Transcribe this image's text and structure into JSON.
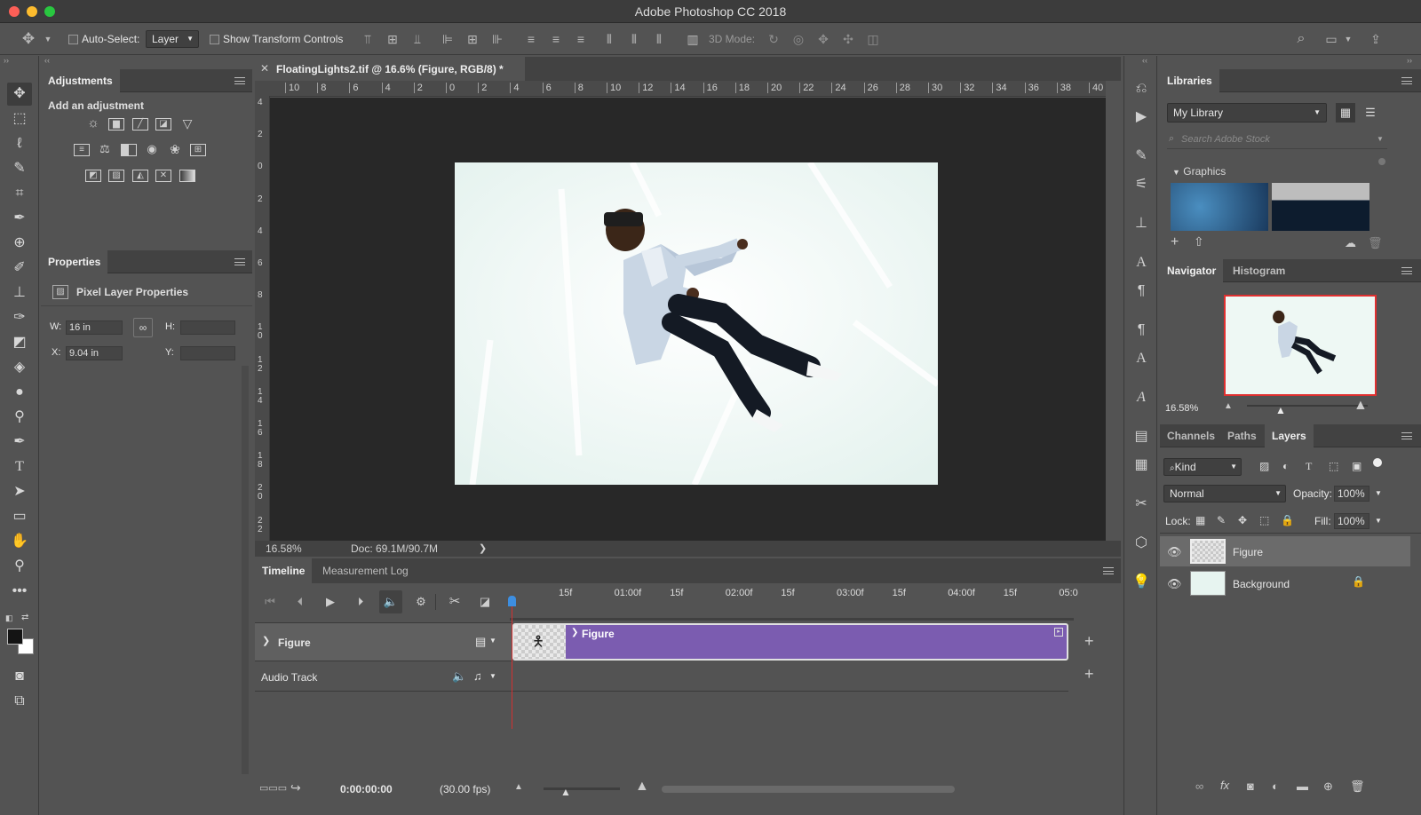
{
  "app": {
    "title": "Adobe Photoshop CC 2018"
  },
  "options_bar": {
    "auto_select_label": "Auto-Select:",
    "auto_select_target": "Layer",
    "show_transform_label": "Show Transform Controls",
    "mode_3d_label": "3D Mode:"
  },
  "adjustments": {
    "tab_label": "Adjustments",
    "subtitle": "Add an adjustment",
    "rows": [
      [
        "brightness-contrast-icon",
        "levels-icon",
        "curves-icon",
        "exposure-icon",
        "vibrance-icon"
      ],
      [
        "hue-saturation-icon",
        "color-balance-icon",
        "black-white-icon",
        "photo-filter-icon",
        "channel-mixer-icon",
        "color-lookup-icon"
      ],
      [
        "invert-icon",
        "posterize-icon",
        "threshold-icon",
        "selective-color-icon",
        "gradient-map-icon"
      ]
    ]
  },
  "properties": {
    "tab_label": "Properties",
    "section_label": "Pixel Layer Properties",
    "w_label": "W:",
    "w_value": "16 in",
    "h_label": "H:",
    "h_value": "",
    "x_label": "X:",
    "x_value": "9.04 in",
    "y_label": "Y:",
    "y_value": ""
  },
  "document": {
    "tab_title": "FloatingLights2.tif @ 16.6% (Figure, RGB/8) *",
    "ruler_h": [
      "10",
      "8",
      "6",
      "4",
      "2",
      "0",
      "2",
      "4",
      "6",
      "8",
      "10",
      "12",
      "14",
      "16",
      "18",
      "20",
      "22",
      "24",
      "26",
      "28",
      "30",
      "32",
      "34",
      "36",
      "38",
      "40"
    ],
    "ruler_v": [
      "4",
      "2",
      "0",
      "2",
      "4",
      "6",
      "8",
      "1\n0",
      "1\n2",
      "1\n4",
      "1\n6",
      "1\n8",
      "2\n0",
      "2\n2"
    ],
    "zoom": "16.58%",
    "doc_size": "Doc: 69.1M/90.7M"
  },
  "timeline": {
    "tabs": [
      "Timeline",
      "Measurement Log"
    ],
    "ticks": [
      "15f",
      "01:00f",
      "15f",
      "02:00f",
      "15f",
      "03:00f",
      "15f",
      "04:00f",
      "15f",
      "05:0"
    ],
    "tracks": [
      {
        "name": "Figure",
        "clip": "Figure"
      },
      {
        "name": "Audio Track"
      }
    ],
    "current_time": "0:00:00:00",
    "fps": "(30.00 fps)"
  },
  "libraries": {
    "tab_label": "Libraries",
    "library_name": "My Library",
    "search_placeholder": "Search Adobe Stock",
    "section_label": "Graphics"
  },
  "navigator": {
    "tabs": [
      "Navigator",
      "Histogram"
    ],
    "zoom": "16.58%"
  },
  "layers_panel": {
    "tabs": [
      "Channels",
      "Paths",
      "Layers"
    ],
    "filter_label": "Kind",
    "blend_mode": "Normal",
    "opacity_label": "Opacity:",
    "opacity_value": "100%",
    "lock_label": "Lock:",
    "fill_label": "Fill:",
    "fill_value": "100%",
    "layers": [
      {
        "name": "Figure",
        "selected": true
      },
      {
        "name": "Background",
        "locked": true
      }
    ]
  },
  "colors": {
    "accent_clip": "#7b5cb0",
    "selected_layer_bg": "#6b6b6b",
    "playhead": "#3d8ee0"
  }
}
